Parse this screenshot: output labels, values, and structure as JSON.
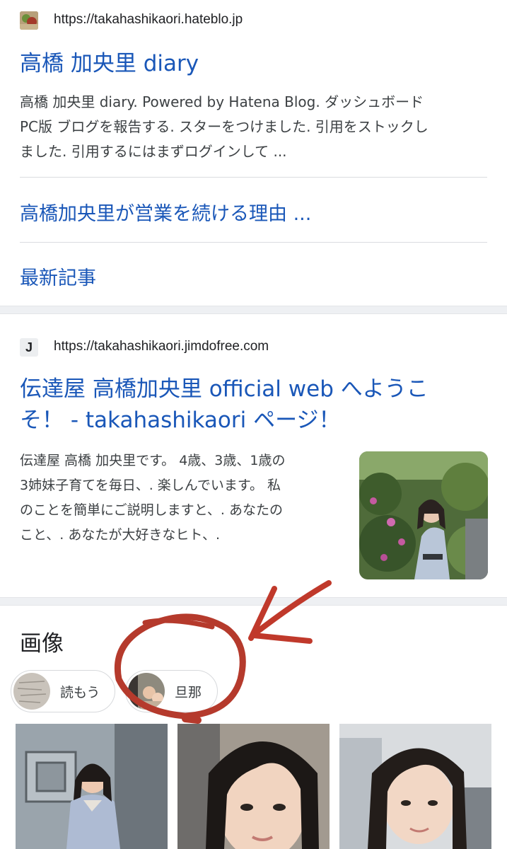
{
  "result1": {
    "favicon": "hatena-blog-favicon",
    "url": "https://takahashikaori.hateblo.jp",
    "title": "高橋 加央里 diary",
    "snippet_line1": "高橋 加央里 diary. Powered by Hatena Blog. ダッシュボード",
    "snippet_line2": "PC版 ブログを報告する. スターをつけました. 引用をストックし",
    "snippet_line3": "ました. 引用するにはまずログインして ...",
    "sitelinks": [
      {
        "label": "高橋加央里が営業を続ける理由 ..."
      },
      {
        "label": "最新記事"
      }
    ]
  },
  "result2": {
    "favicon_letter": "J",
    "url": "https://takahashikaori.jimdofree.com",
    "title_line1": "伝達屋 高橋加央里 official web へようこ",
    "title_line2": "そ！ - takahashikaori ページ！",
    "snippet_line1": "伝達屋 高橋 加央里です。 4歳、3歳、1歳の",
    "snippet_line2": "3姉妹子育てを毎日、. 楽しんでいます。 私",
    "snippet_line3": "のことを簡単にご説明しますと、. あなたの",
    "snippet_line4": "こと、. あなたが大好きなヒト、."
  },
  "images_section": {
    "title": "画像",
    "chips": [
      {
        "label": "読もう"
      },
      {
        "label": "旦那"
      }
    ]
  },
  "colors": {
    "link": "#1a57b8",
    "annotation": "#c0392b"
  }
}
